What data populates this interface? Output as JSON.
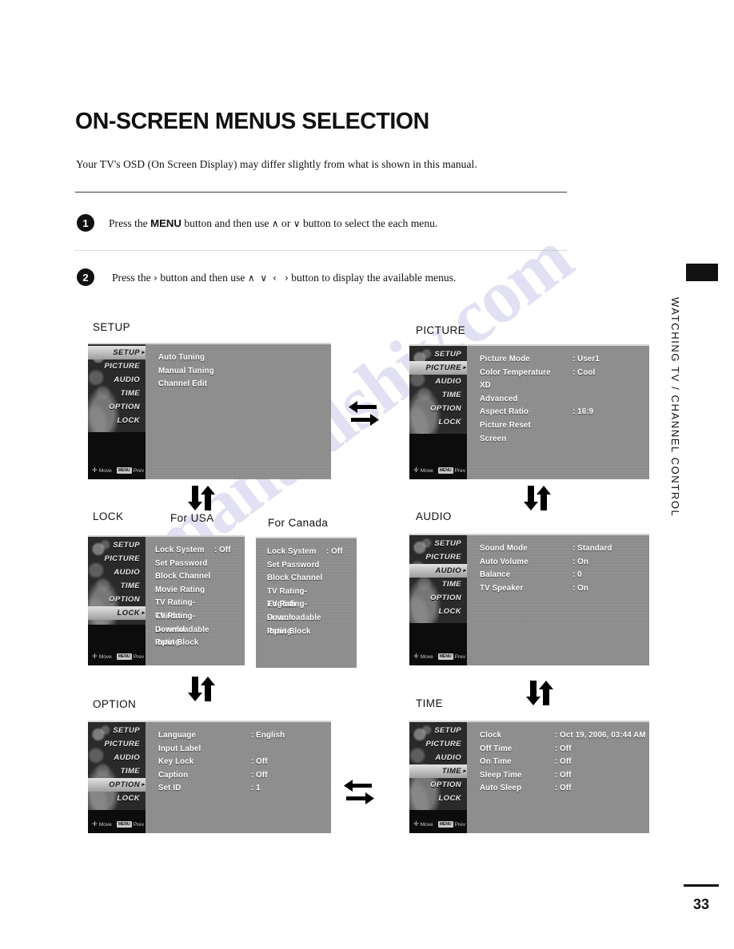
{
  "document": {
    "title": "ON-SCREEN MENUS SELECTION",
    "subtitle": "Your TV's OSD (On Screen Display) may differ slightly from what is shown in this manual.",
    "side_tab_text": "WATCHING TV / CHANNEL CONTROL",
    "page_number": "33",
    "watermark": "manualshiv.com"
  },
  "steps": [
    {
      "number": "1",
      "text_before": "Press the ",
      "bold": "MENU",
      "text_mid": " button and then use ",
      "glyph1": "∧",
      "text_or": " or ",
      "glyph2": "∨",
      "text_after": " button to select the each menu."
    },
    {
      "number": "2",
      "text_before": "Press the ",
      "glyph0": "›",
      "text_mid": " button and then use ",
      "glyph1": "∧",
      "glyph2": "∨",
      "glyph3": "‹",
      "glyph4": "›",
      "text_after": " button to display the available menus."
    }
  ],
  "osd_sidebar_items": [
    "SETUP",
    "PICTURE",
    "AUDIO",
    "TIME",
    "OPTION",
    "LOCK"
  ],
  "osd_hint": {
    "move": "Move",
    "move_icon": "cross-arrows-icon",
    "prev_badge": "MENU",
    "prev": "Prev"
  },
  "panels": {
    "setup": {
      "label": "SETUP",
      "active": "SETUP",
      "rows": [
        {
          "label": "Auto Tuning",
          "value": ""
        },
        {
          "label": "Manual Tuning",
          "value": ""
        },
        {
          "label": "Channel Edit",
          "value": ""
        }
      ]
    },
    "picture": {
      "label": "PICTURE",
      "active": "PICTURE",
      "rows": [
        {
          "label": "Picture Mode",
          "value": ": User1"
        },
        {
          "label": "Color Temperature",
          "value": ": Cool"
        },
        {
          "label": "XD",
          "value": ""
        },
        {
          "label": "Advanced",
          "value": ""
        },
        {
          "label": "Aspect Ratio",
          "value": ": 16:9"
        },
        {
          "label": "Picture Reset",
          "value": ""
        },
        {
          "label": "Screen",
          "value": ""
        }
      ]
    },
    "lock_usa": {
      "label": "LOCK",
      "sublabel": "For USA",
      "active": "LOCK",
      "rows": [
        {
          "label": "Lock System",
          "value": ": Off"
        },
        {
          "label": "Set Password",
          "value": ""
        },
        {
          "label": "Block Channel",
          "value": ""
        },
        {
          "label": "Movie Rating",
          "value": ""
        },
        {
          "label": "TV Rating-Children",
          "value": ""
        },
        {
          "label": "TV Rating-General",
          "value": ""
        },
        {
          "label": "Downloadable Rating",
          "value": ""
        },
        {
          "label": "Input Block",
          "value": ""
        }
      ]
    },
    "lock_canada": {
      "sublabel": "For Canada",
      "rows": [
        {
          "label": "Lock System",
          "value": ": Off"
        },
        {
          "label": "Set Password",
          "value": ""
        },
        {
          "label": "Block Channel",
          "value": ""
        },
        {
          "label": "TV Rating-English",
          "value": ""
        },
        {
          "label": "TV Rating-French",
          "value": ""
        },
        {
          "label": "Downloadable Rating",
          "value": ""
        },
        {
          "label": "Input Block",
          "value": ""
        }
      ]
    },
    "audio": {
      "label": "AUDIO",
      "active": "AUDIO",
      "rows": [
        {
          "label": "Sound Mode",
          "value": ": Standard"
        },
        {
          "label": "Auto Volume",
          "value": ": On"
        },
        {
          "label": "Balance",
          "value": ": 0"
        },
        {
          "label": "TV Speaker",
          "value": ": On"
        }
      ]
    },
    "option": {
      "label": "OPTION",
      "active": "OPTION",
      "rows": [
        {
          "label": "Language",
          "value": ": English"
        },
        {
          "label": "Input Label",
          "value": ""
        },
        {
          "label": "Key Lock",
          "value": ": Off"
        },
        {
          "label": "Caption",
          "value": ": Off"
        },
        {
          "label": "Set ID",
          "value": ": 1"
        }
      ]
    },
    "time": {
      "label": "TIME",
      "active": "TIME",
      "rows": [
        {
          "label": "Clock",
          "value": ": Oct 19, 2006, 03:44 AM"
        },
        {
          "label": "Off Time",
          "value": ": Off"
        },
        {
          "label": "On Time",
          "value": ": Off"
        },
        {
          "label": "Sleep Time",
          "value": ": Off"
        },
        {
          "label": "Auto Sleep",
          "value": ": Off"
        }
      ]
    }
  },
  "colors": {
    "osd_bg": "#8e8e8e",
    "osd_sidebar": "#0c0c0c",
    "text_white": "#ffffff",
    "ink": "#111111",
    "watermark": "#7878c8"
  }
}
